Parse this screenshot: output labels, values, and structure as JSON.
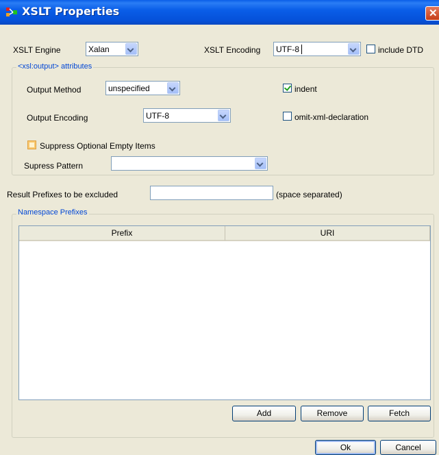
{
  "window": {
    "title": "XSLT Properties",
    "close_symbol": "✕"
  },
  "xslt_engine": {
    "label": "XSLT Engine",
    "value": "Xalan"
  },
  "xslt_encoding": {
    "label": "XSLT Encoding",
    "value": "UTF-8"
  },
  "include_dtd": {
    "label": "include DTD",
    "checked": false
  },
  "output_group": {
    "legend": "<xsl:output> attributes",
    "output_method": {
      "label": "Output Method",
      "value": "unspecified"
    },
    "indent": {
      "label": "indent",
      "checked": true
    },
    "output_encoding": {
      "label": "Output Encoding",
      "value": "UTF-8"
    },
    "omit_xml_declaration": {
      "label": "omit-xml-declaration",
      "checked": false
    },
    "suppress_optional": {
      "label": "Suppress Optional Empty Items",
      "checked": false
    },
    "suppress_pattern": {
      "label": "Supress Pattern",
      "value": ""
    }
  },
  "result_prefixes": {
    "label": "Result Prefixes to be excluded",
    "value": "",
    "hint": "(space separated)"
  },
  "namespace_group": {
    "legend": "Namespace Prefixes",
    "columns": [
      "Prefix",
      "URI"
    ],
    "rows": [],
    "buttons": {
      "add": "Add",
      "remove": "Remove",
      "fetch": "Fetch"
    }
  },
  "footer": {
    "ok": "Ok",
    "cancel": "Cancel"
  },
  "colors": {
    "titlebar": "#0a5ee8",
    "dialog_bg": "#ece9d8",
    "legend_text": "#0046d5",
    "field_border": "#7f9db9"
  }
}
